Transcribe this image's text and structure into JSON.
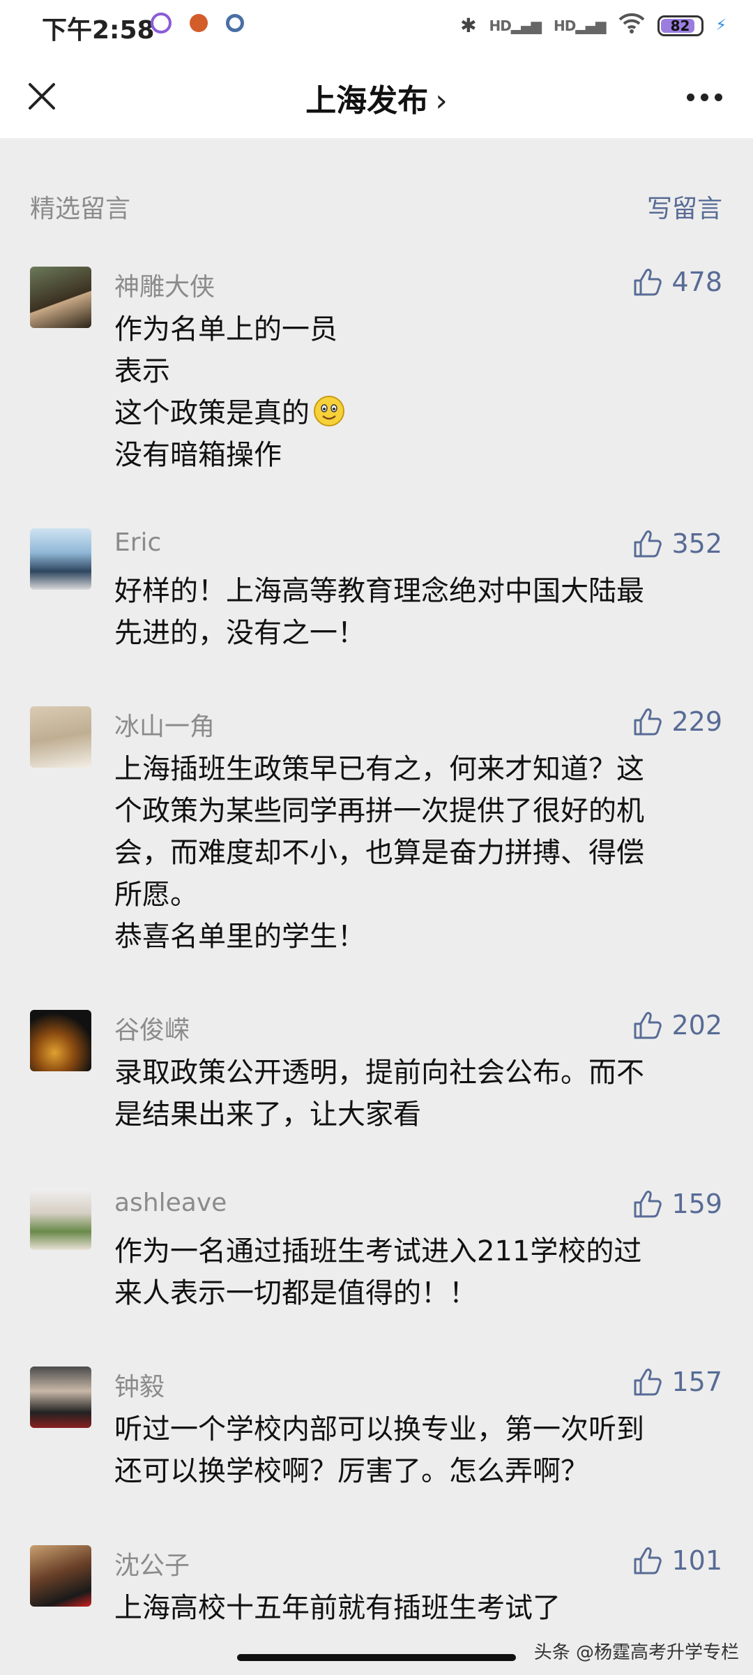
{
  "status_bar": {
    "time": "下午2:58",
    "battery": "82",
    "icons": [
      "alarm-icon",
      "app-icon",
      "app-icon",
      "bluetooth-icon",
      "signal-hd-icon",
      "signal-hd-icon",
      "wifi-icon",
      "battery-icon",
      "charging-icon"
    ],
    "signal_label": "HD"
  },
  "header": {
    "title": "上海发布",
    "chevron": "›"
  },
  "section": {
    "title": "精选留言",
    "write_label": "写留言"
  },
  "comments": [
    {
      "name": "神雕大侠",
      "likes": "478",
      "lines": [
        "作为名单上的一员",
        "表示",
        "这个政策是真的",
        "没有暗箱操作"
      ],
      "emoji": "smile-emoji"
    },
    {
      "name": "Eric",
      "likes": "352",
      "lines": [
        "好样的！上海高等教育理念绝对中国大陆最",
        "先进的，没有之一！"
      ]
    },
    {
      "name": "冰山一角",
      "likes": "229",
      "lines": [
        "上海插班生政策早已有之，何来才知道？这",
        "个政策为某些同学再拼一次提供了很好的机",
        "会，而难度却不小，也算是奋力拼搏、得偿",
        "所愿。",
        "恭喜名单里的学生！"
      ]
    },
    {
      "name": "谷俊嵘",
      "likes": "202",
      "lines": [
        "录取政策公开透明，提前向社会公布。而不",
        "是结果出来了，让大家看"
      ]
    },
    {
      "name": "ashleave",
      "likes": "159",
      "lines": [
        "作为一名通过插班生考试进入211学校的过",
        "来人表示一切都是值得的！！"
      ]
    },
    {
      "name": "钟毅",
      "likes": "157",
      "lines": [
        "听过一个学校内部可以换专业，第一次听到",
        "还可以换学校啊？厉害了。怎么弄啊？"
      ]
    },
    {
      "name": "沈公子",
      "likes": "101",
      "lines": [
        "上海高校十五年前就有插班生考试了"
      ]
    }
  ],
  "watermark": "头条 @杨霆高考升学专栏",
  "colors": {
    "background": "#ededed",
    "link": "#576b95",
    "muted": "#8b8b8b",
    "text": "#111111"
  }
}
